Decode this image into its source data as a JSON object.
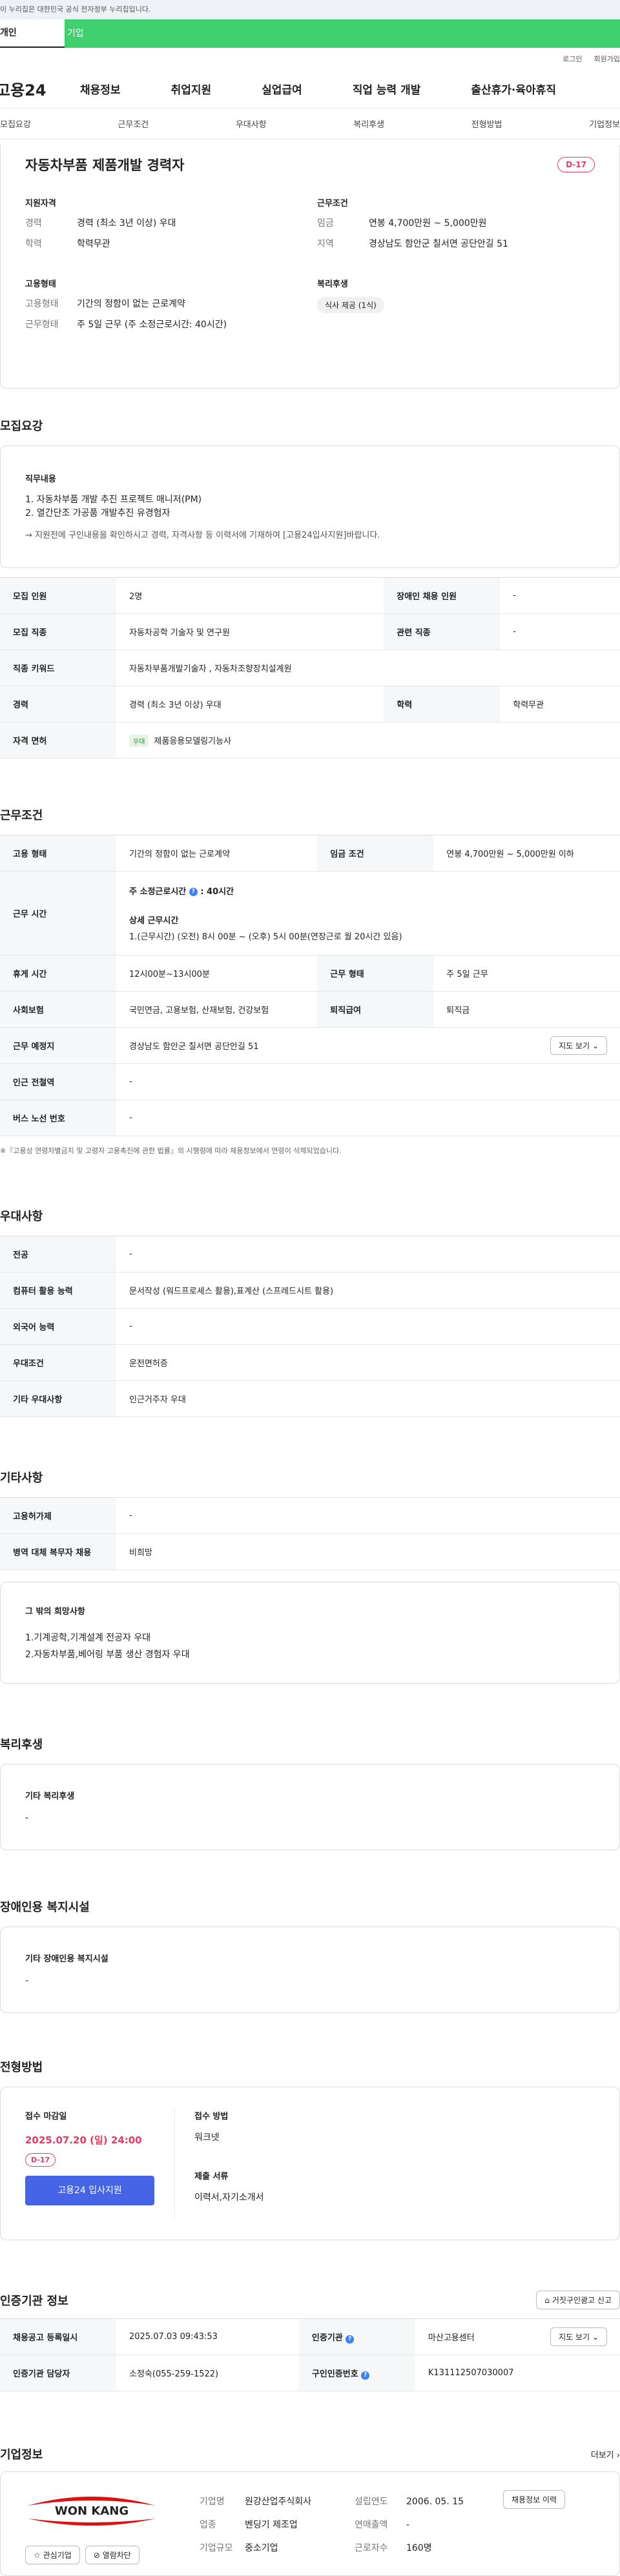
{
  "gov_banner": "이 누리집은 대한민국 공식 전자정부 누리집입니다.",
  "user_tabs": {
    "personal": "개인",
    "company": "기업"
  },
  "util": {
    "login": "로그인",
    "signup": "회원가입"
  },
  "logo": "고용24",
  "gnb": [
    "채용정보",
    "취업지원",
    "실업급여",
    "직업 능력 개발",
    "출산휴가·육아휴직"
  ],
  "subnav": [
    "모집요강",
    "근무조건",
    "우대사항",
    "복리후생",
    "전형방법",
    "기업정보"
  ],
  "summary": {
    "title": "자동차부품 제품개발 경력자",
    "dday": "D-17",
    "qual_title": "지원자격",
    "career_k": "경력",
    "career_v": "경력 (최소 3년 이상) 우대",
    "edu_k": "학력",
    "edu_v": "학력무관",
    "cond_title": "근무조건",
    "wage_k": "임금",
    "wage_v": "연봉 4,700만원 ~ 5,000만원",
    "region_k": "지역",
    "region_v": "경상남도 함안군 칠서면 공단안길 51",
    "emp_title": "고용형태",
    "etype_k": "고용형태",
    "etype_v": "기간의 정함이 없는 근로계약",
    "ework_k": "근무형태",
    "ework_v": "주 5일 근무 (주 소정근로시간: 40시간)",
    "welfare_title": "복리후생",
    "welfare_chip": "식사 제공 (1식)"
  },
  "recruit": {
    "title": "모집요강",
    "job_title": "직무내용",
    "job_lines": [
      "1. 자동차부품 개발 추진 프로젝트 매니저(PM)",
      "2. 열간단조 가공품 개발추진 유경험자"
    ],
    "job_note": "→ 지원전에 구인내용을 확인하시고 경력, 자격사항 등 이력서에 기재하여 [고용24입사지원]바랍니다.",
    "rows": [
      [
        "모집 인원",
        "2명",
        "장애인 채용 인원",
        "-"
      ],
      [
        "모집 직종",
        "자동차공학 기술자 및 연구원",
        "관련 직종",
        "-"
      ]
    ],
    "keyword_k": "직종 키워드",
    "keyword_v": "자동차부품개발기술자 , 자동차조향장치설계원",
    "career_k": "경력",
    "career_v": "경력 (최소 3년 이상) 우대",
    "edu_k": "학력",
    "edu_v": "학력무관",
    "license_k": "자격 면허",
    "license_badge": "우대",
    "license_v": "제품응용모델링기능사"
  },
  "work": {
    "title": "근무조건",
    "type_k": "고용 형태",
    "type_v": "기간의 정함이 없는 근로계약",
    "wage_k": "임금 조건",
    "wage_v": "연봉 4,700만원 ~ 5,000만원 이하",
    "time_k": "근무 시간",
    "time_week_label": "주 소정근로시간",
    "time_week_v": ": 40시간",
    "time_detail_label": "상세 근무시간",
    "time_detail_v": "1.(근무시간) (오전) 8시 00분 ~ (오후) 5시 00분(연장근로 월 20시간 있음)",
    "break_k": "휴게 시간",
    "break_v": "12시00분~13시00분",
    "form_k": "근무 형태",
    "form_v": "주 5일 근무",
    "ins_k": "사회보험",
    "ins_v": "국민연금, 고용보험, 산재보험, 건강보험",
    "ret_k": "퇴직급여",
    "ret_v": "퇴직금",
    "place_k": "근무 예정지",
    "place_v": "경상남도 함안군 칠서면 공단안길 51",
    "map_btn": "지도 보기",
    "station_k": "인근 전철역",
    "station_v": "-",
    "bus_k": "버스 노선 번호",
    "bus_v": "-",
    "note": "※『고용상 연령차별금지 및 고령자 고용촉진에 관한 법률』의 시행령에 따라 채용정보에서 연령이 삭제되었습니다."
  },
  "pref": {
    "title": "우대사항",
    "rows": [
      [
        "전공",
        "-"
      ],
      [
        "컴퓨터 활용 능력",
        "문서작성 (워드프로세스 활용),표계산 (스프레드시트 활용)"
      ],
      [
        "외국어 능력",
        "-"
      ],
      [
        "우대조건",
        "운전면허증"
      ],
      [
        "기타 우대사항",
        "인근거주자 우대"
      ]
    ]
  },
  "etc": {
    "title": "기타사항",
    "rows": [
      [
        "고용허가제",
        "-"
      ],
      [
        "병역 대체 복무자 채용",
        "비희망"
      ]
    ],
    "wish_title": "그 밖의 희망사항",
    "wish_lines": [
      "1.기계공학,기계설계 전공자 우대",
      "2.자동차부품,베어링 부품 생산 경험자 우대"
    ]
  },
  "benefit": {
    "title": "복리후생",
    "box_title": "기타 복리후생",
    "box_v": "-"
  },
  "disab": {
    "title": "장애인용 복지시설",
    "box_title": "기타 장애인용 복지시설",
    "box_v": "-"
  },
  "process": {
    "title": "전형방법",
    "deadline_label": "접수 마감일",
    "deadline_v": "2025.07.20 (일) 24:00",
    "dday": "D-17",
    "apply_btn": "고용24 입사지원",
    "method_label": "접수 방법",
    "method_v": "워크넷",
    "docs_label": "제출 서류",
    "docs_v": "이력서,자기소개서"
  },
  "cert": {
    "title": "인증기관 정보",
    "report_btn": "거짓구인광고 신고",
    "reg_k": "채용공고 등록일시",
    "reg_v": "2025.07.03 09:43:53",
    "org_k": "인증기관",
    "org_v": "마산고용센터",
    "map_btn": "지도 보기",
    "mgr_k": "인증기관 담당자",
    "mgr_v": "소정숙(055-259-1522)",
    "no_k": "구인인증번호",
    "no_v": "K131112507030007"
  },
  "company": {
    "title": "기업정보",
    "more": "더보기",
    "logo_text": "WON KANG",
    "name_k": "기업명",
    "name_v": "원강산업주식회사",
    "year_k": "설립연도",
    "year_v": "2006. 05. 15",
    "ind_k": "업종",
    "ind_v": "벤딩기 제조업",
    "sales_k": "연매출액",
    "sales_v": "-",
    "size_k": "기업규모",
    "size_v": "중소기업",
    "staff_k": "근로자수",
    "staff_v": "160명",
    "history_btn": "채용정보 이력",
    "fav_btn": "관심기업",
    "block_btn": "열람차단"
  }
}
